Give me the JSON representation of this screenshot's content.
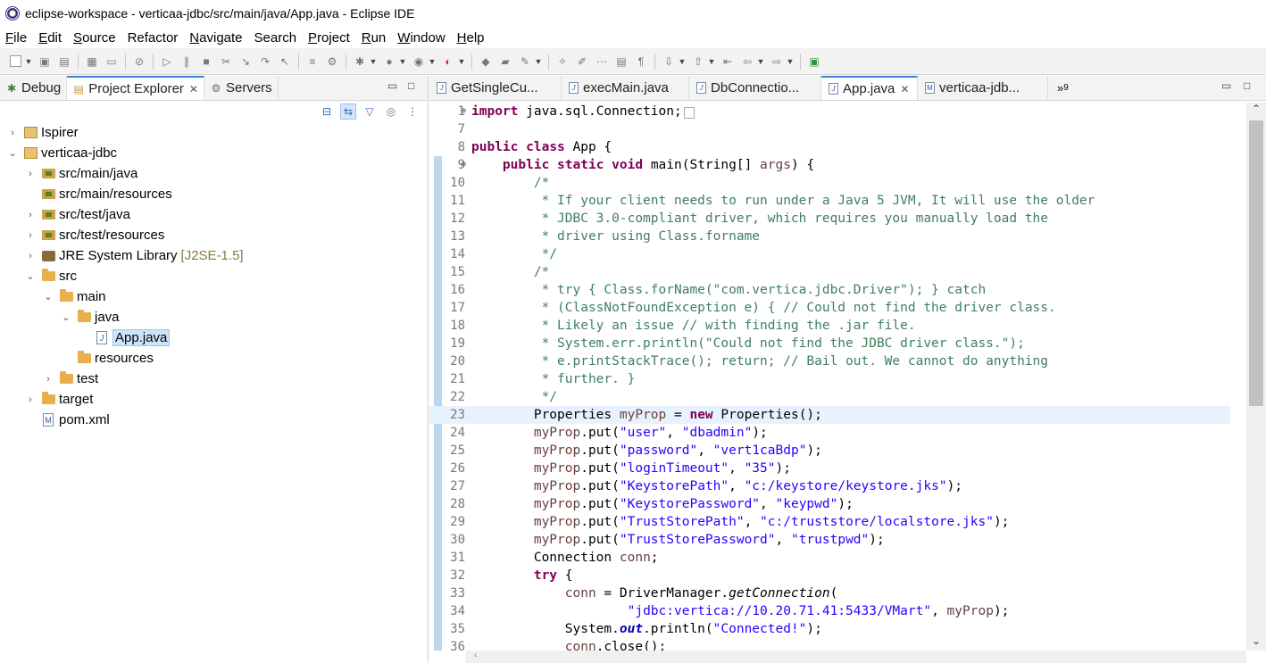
{
  "window": {
    "title": "eclipse-workspace - verticaa-jdbc/src/main/java/App.java - Eclipse IDE"
  },
  "menu": [
    {
      "label": "File",
      "u": "F",
      "rest": "ile"
    },
    {
      "label": "Edit",
      "u": "E",
      "rest": "dit"
    },
    {
      "label": "Source",
      "u": "S",
      "rest": "ource"
    },
    {
      "label": "Refactor",
      "u": "",
      "rest": "Refactor"
    },
    {
      "label": "Navigate",
      "u": "N",
      "rest": "avigate"
    },
    {
      "label": "Search",
      "u": "",
      "rest": "Search"
    },
    {
      "label": "Project",
      "u": "P",
      "rest": "roject"
    },
    {
      "label": "Run",
      "u": "R",
      "rest": "un"
    },
    {
      "label": "Window",
      "u": "W",
      "rest": "indow"
    },
    {
      "label": "Help",
      "u": "H",
      "rest": "elp"
    }
  ],
  "left_tabs": {
    "debug": "Debug",
    "explorer": "Project Explorer",
    "servers": "Servers"
  },
  "tree": [
    {
      "label": "Ispirer",
      "decor": ""
    },
    {
      "label": "verticaa-jdbc",
      "decor": ""
    },
    {
      "label": "src/main/java",
      "decor": ""
    },
    {
      "label": "src/main/resources",
      "decor": ""
    },
    {
      "label": "src/test/java",
      "decor": ""
    },
    {
      "label": "src/test/resources",
      "decor": ""
    },
    {
      "label": "JRE System Library",
      "decor": "[J2SE-1.5]"
    },
    {
      "label": "src",
      "decor": ""
    },
    {
      "label": "main",
      "decor": ""
    },
    {
      "label": "java",
      "decor": ""
    },
    {
      "label": "App.java",
      "decor": ""
    },
    {
      "label": "resources",
      "decor": ""
    },
    {
      "label": "test",
      "decor": ""
    },
    {
      "label": "target",
      "decor": ""
    },
    {
      "label": "pom.xml",
      "decor": ""
    }
  ],
  "editor_tabs": [
    {
      "label": "GetSingleCu..."
    },
    {
      "label": "execMain.java"
    },
    {
      "label": "DbConnectio..."
    },
    {
      "label": "App.java"
    },
    {
      "label": "verticaa-jdb..."
    }
  ],
  "more_tabs": "9",
  "code": {
    "line_numbers": [
      "1",
      "7",
      "8",
      "9",
      "10",
      "11",
      "12",
      "13",
      "14",
      "15",
      "16",
      "17",
      "18",
      "19",
      "20",
      "21",
      "22",
      "23",
      "24",
      "25",
      "26",
      "27",
      "28",
      "29",
      "30",
      "31",
      "32",
      "33",
      "34",
      "35",
      "36"
    ],
    "l1_kw": "import",
    "l1_rest": " java.sql.Connection;",
    "l8_kw1": "public",
    "l8_kw2": "class",
    "l8_rest": " App {",
    "l9_kw1": "public",
    "l9_kw2": "static",
    "l9_kw3": "void",
    "l9_rest": " main(String[] ",
    "l9_var": "args",
    "l9_end": ") {",
    "l10": "/*",
    "l11": " * If your client needs to run under a Java 5 JVM, It will use the older",
    "l12": " * JDBC 3.0-compliant driver, which requires you manually load the",
    "l13": " * driver using Class.forname",
    "l14": " */",
    "l15": "/*",
    "l16": " * try { Class.forName(\"com.vertica.jdbc.Driver\"); } catch",
    "l17": " * (ClassNotFoundException e) { // Could not find the driver class.",
    "l18": " * Likely an issue // with finding the .jar file.",
    "l19": " * System.err.println(\"Could not find the JDBC driver class.\");",
    "l20": " * e.printStackTrace(); return; // Bail out. We cannot do anything",
    "l21": " * further. }",
    "l22": " */",
    "l23_a": "Properties ",
    "l23_var": "myProp",
    "l23_b": " = ",
    "l23_kw": "new",
    "l23_c": " Properties();",
    "put_lines": [
      {
        "key": "\"user\"",
        "val": "\"dbadmin\""
      },
      {
        "key": "\"password\"",
        "val": "\"vert1caBdp\""
      },
      {
        "key": "\"loginTimeout\"",
        "val": "\"35\""
      },
      {
        "key": "\"KeystorePath\"",
        "val": "\"c:/keystore/keystore.jks\""
      },
      {
        "key": "\"KeystorePassword\"",
        "val": "\"keypwd\""
      },
      {
        "key": "\"TrustStorePath\"",
        "val": "\"c:/truststore/localstore.jks\""
      },
      {
        "key": "\"TrustStorePassword\"",
        "val": "\"trustpwd\""
      }
    ],
    "put_prefix": "myProp",
    "put_mid": ".put(",
    "l31_a": "Connection ",
    "l31_var": "conn",
    "l31_b": ";",
    "l32_kw": "try",
    "l32_rest": " {",
    "l33_var": "conn",
    "l33_a": " = DriverManager.",
    "l33_it": "getConnection",
    "l33_b": "(",
    "l34_str": "\"jdbc:vertica://10.20.71.41:5433/VMart\"",
    "l34_a": ", ",
    "l34_var": "myProp",
    "l34_b": ");",
    "l35_a": "System.",
    "l35_fld": "out",
    "l35_b": ".println(",
    "l35_str": "\"Connected!\"",
    "l35_c": ");",
    "l36_var": "conn",
    "l36_a": ".close();"
  }
}
